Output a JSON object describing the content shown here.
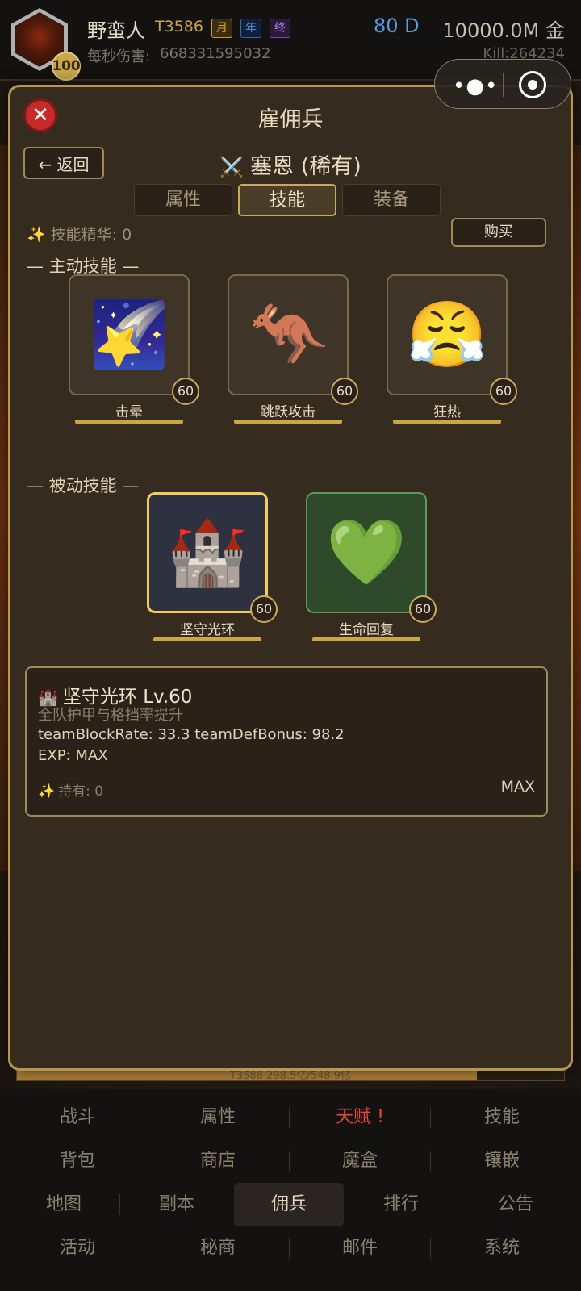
{
  "header": {
    "avatar_level": "100",
    "player_name": "野蛮人",
    "tier": "T3586",
    "badges": [
      "月",
      "年",
      "终"
    ],
    "dps_label": "每秒伤害:",
    "dps_value": "668331595032",
    "currency_d": "80 D",
    "currency_gold": "10000.0M 金",
    "kill": "Kill:264234"
  },
  "capsule": {
    "more_icon": "more-dots-icon",
    "close_icon": "target-icon"
  },
  "background": {
    "progress_text": "T3588  298.5亿/548.9亿",
    "progress": 0.84
  },
  "modal": {
    "title": "雇佣兵",
    "back_label": "← 返回",
    "merc_icon": "⚔️",
    "merc_name": "塞恩 (稀有)",
    "tabs": [
      "属性",
      "技能",
      "装备"
    ],
    "active_tab": "技能",
    "essence_label": "技能精华: 0",
    "buy_label": "购买",
    "active_title": "— 主动技能 —",
    "active_skills": [
      {
        "name": "击晕",
        "level": "60",
        "icon": "🌠"
      },
      {
        "name": "跳跃攻击",
        "level": "60",
        "icon": "🦘"
      },
      {
        "name": "狂热",
        "level": "60",
        "icon": "😤"
      }
    ],
    "passive_title": "— 被动技能 —",
    "passive_skills": [
      {
        "name": "坚守光环",
        "level": "60",
        "icon": "🏰"
      },
      {
        "name": "生命回复",
        "level": "60",
        "icon": "💚"
      }
    ],
    "info": {
      "icon": "🏰",
      "title": "坚守光环  Lv.60",
      "desc": "全队护甲与格挡率提升",
      "stats": "teamBlockRate: 33.3  teamDefBonus: 98.2",
      "exp": "EXP: MAX",
      "hold": "持有: 0",
      "max": "MAX"
    }
  },
  "nav": {
    "row1": [
      "战斗",
      "属性",
      "天赋 !",
      "技能"
    ],
    "row2": [
      "背包",
      "商店",
      "魔盒",
      "镶嵌"
    ],
    "row3": [
      "地图",
      "副本",
      "佣兵",
      "排行",
      "公告"
    ],
    "row4": [
      "活动",
      "秘商",
      "邮件",
      "系统"
    ],
    "active": "佣兵",
    "alert": "天赋 !"
  },
  "colors": {
    "accent_gold": "#c9a64a",
    "alert_red": "#e04a3a",
    "close_red": "#c82a2a",
    "gem_blue": "#5a9ae0"
  }
}
